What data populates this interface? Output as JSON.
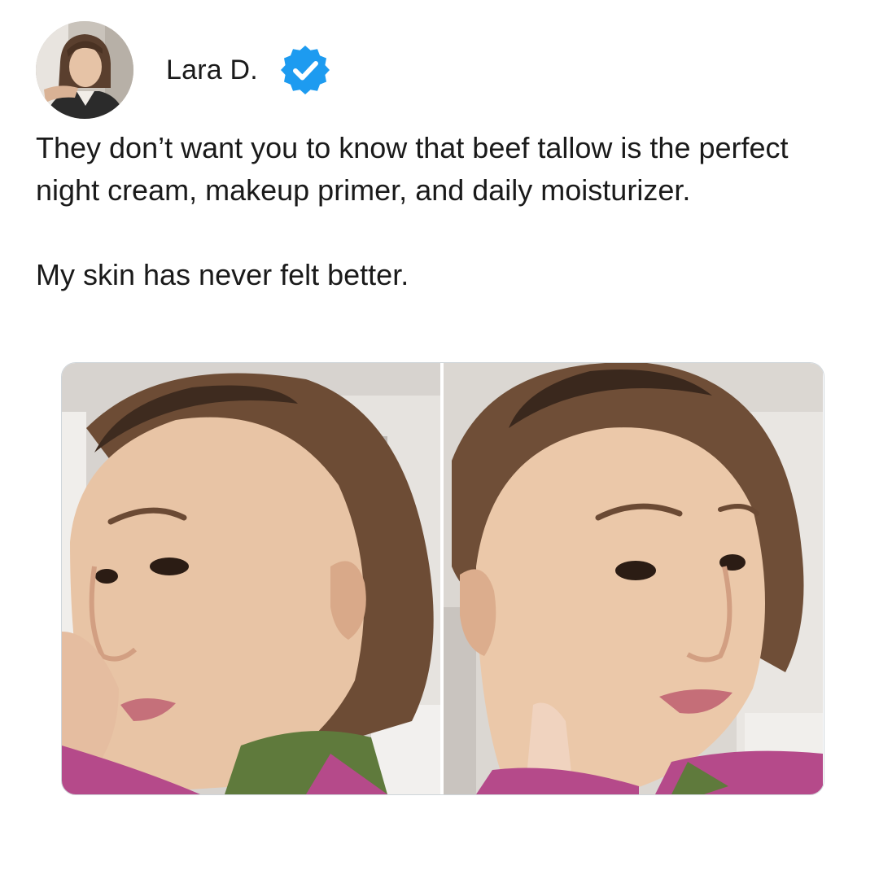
{
  "author": {
    "name": "Lara D.",
    "verified": true,
    "avatar_icon": "profile-photo"
  },
  "post": {
    "paragraphs": [
      "They don’t want you to know that beef tallow is the perfect night cream, makeup primer, and daily moisturizer.",
      "My skin has never felt better."
    ]
  },
  "media": {
    "photos": [
      {
        "icon": "selfie-left-profile-photo"
      },
      {
        "icon": "selfie-right-profile-photo"
      }
    ]
  },
  "colors": {
    "verified_badge": "#1d9bf0",
    "text": "#1a1a1a",
    "background": "#ffffff",
    "media_border": "#cfd5da"
  }
}
